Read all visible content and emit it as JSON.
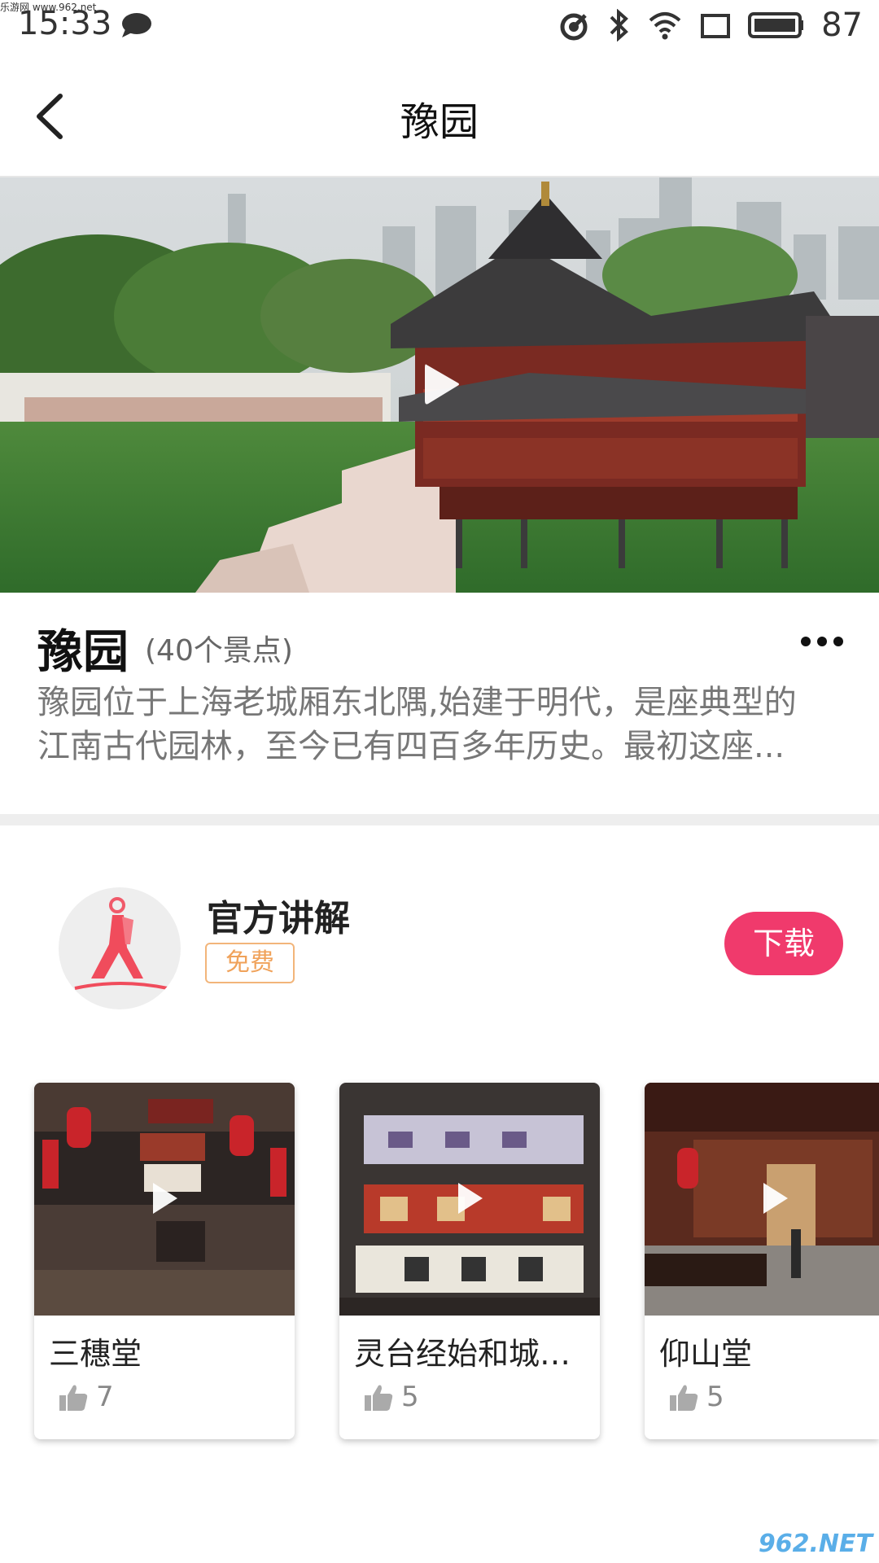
{
  "status_bar": {
    "time": "15:33",
    "watermark": "乐游网 www.962.net",
    "battery": "87",
    "icons": [
      "chat-icon",
      "sync-icon",
      "bluetooth-icon",
      "wifi-icon",
      "screen-icon",
      "battery-icon"
    ]
  },
  "header": {
    "title": "豫园",
    "back_icon": "back-arrow-icon"
  },
  "place": {
    "name": "豫园",
    "count": "(40个景点)",
    "description_line1": "豫园位于上海老城厢东北隅,始建于明代，是座典型的",
    "description_line2": "江南古代园林，至今已有四百多年历史。最初这座..."
  },
  "official": {
    "title": "官方讲解",
    "badge": "免费",
    "download": "下载"
  },
  "cards": [
    {
      "name": "三穗堂",
      "likes": "7"
    },
    {
      "name": "灵台经始和城市...",
      "likes": "5"
    },
    {
      "name": "仰山堂",
      "likes": "5"
    }
  ],
  "footer": {
    "logo": "962.NET"
  },
  "colors": {
    "accent": "#f03a6c",
    "badge": "#f0a25a"
  }
}
